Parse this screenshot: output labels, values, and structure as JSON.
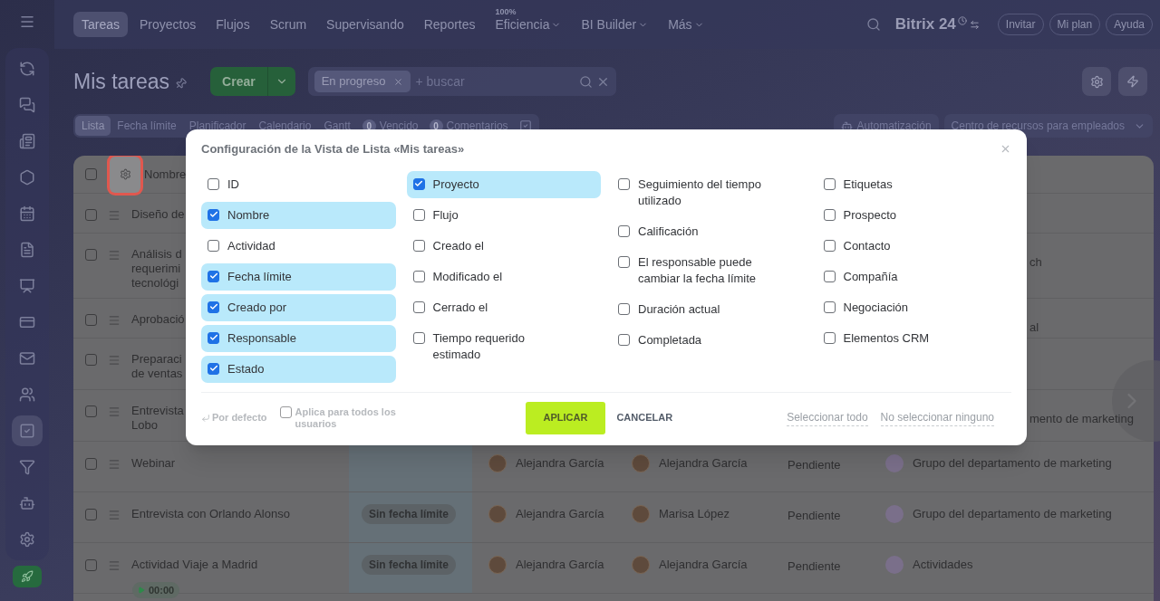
{
  "nav": {
    "items": [
      {
        "label": "Tareas",
        "selected": true
      },
      {
        "label": "Proyectos",
        "selected": false
      },
      {
        "label": "Flujos",
        "selected": false
      },
      {
        "label": "Scrum",
        "selected": false
      },
      {
        "label": "Supervisando",
        "selected": false
      },
      {
        "label": "Reportes",
        "selected": false
      },
      {
        "label": "Eficiencia",
        "selected": false,
        "badge": "100%",
        "dropdown": true
      },
      {
        "label": "BI Builder",
        "selected": false,
        "dropdown": true
      },
      {
        "label": "Más",
        "selected": false,
        "dropdown": true
      }
    ],
    "logo": "Bitrix 24",
    "buttons": [
      "Invitar",
      "Mi plan",
      "Ayuda"
    ]
  },
  "sidebar": {
    "items": [
      {
        "selected": false
      },
      {
        "selected": false
      },
      {
        "selected": false
      },
      {
        "selected": false
      },
      {
        "selected": false
      },
      {
        "selected": false
      },
      {
        "selected": false
      },
      {
        "selected": false
      },
      {
        "selected": false
      },
      {
        "selected": false
      },
      {
        "selected": true
      },
      {
        "selected": false
      },
      {
        "selected": false
      },
      {
        "selected": false
      }
    ]
  },
  "page": {
    "title": "Mis tareas",
    "create_button": "Crear",
    "search": {
      "chip": "En progreso",
      "placeholder": "+ buscar"
    }
  },
  "views": [
    {
      "label": "Lista",
      "selected": true
    },
    {
      "label": "Fecha límite",
      "selected": false
    },
    {
      "label": "Planificador",
      "selected": false
    },
    {
      "label": "Calendario",
      "selected": false
    },
    {
      "label": "Gantt",
      "selected": false
    }
  ],
  "counters": [
    {
      "count": "0",
      "label": "Vencido"
    },
    {
      "count": "0",
      "label": "Comentarios"
    }
  ],
  "automation": "Automatización",
  "resources": "Centro de recursos para empleados",
  "table": {
    "header": "Nombre",
    "header_checked": false,
    "rows": [
      {
        "kind": "partial",
        "checked": false,
        "name": "Diseño de"
      },
      {
        "kind": "partial",
        "checked": false,
        "name": "Análisis d\nrequerimi\ntecnológi",
        "end": "ch"
      },
      {
        "kind": "partial",
        "checked": false,
        "name": "Aprobació",
        "end": "al"
      },
      {
        "kind": "partial",
        "checked": false,
        "name": "Preparaci\nde ventas"
      },
      {
        "kind": "partial",
        "checked": false,
        "name": "Entrevista\nLobo",
        "end": "mento de marketing"
      },
      {
        "kind": "full",
        "checked": false,
        "name": "Webinar",
        "responsible": "Alejandra García",
        "creator": "Alejandra García",
        "status": "Pendiente",
        "project": "Grupo del departamento de marketing"
      },
      {
        "kind": "full",
        "checked": false,
        "name": "Entrevista con Orlando Alonso",
        "deadline": "Sin fecha límite",
        "responsible": "Alejandra García",
        "creator": "Marisa López",
        "status": "Pendiente",
        "project": "Grupo del departamento de marketing"
      },
      {
        "kind": "full",
        "checked": false,
        "name": "Actividad Viaje a Madrid",
        "deadline": "Sin fecha límite",
        "responsible": "Alejandra García",
        "creator": "Alejandra García",
        "status": "Pendiente",
        "project": "Actividades",
        "timer": "00:00"
      }
    ]
  },
  "dialog": {
    "title": "Configuración de la Vista de Lista «Mis tareas»",
    "columns": [
      [
        {
          "label": "ID",
          "checked": false
        },
        {
          "label": "Nombre",
          "checked": true
        },
        {
          "label": "Actividad",
          "checked": false
        },
        {
          "label": "Fecha límite",
          "checked": true
        },
        {
          "label": "Creado por",
          "checked": true
        },
        {
          "label": "Responsable",
          "checked": true
        },
        {
          "label": "Estado",
          "checked": true
        }
      ],
      [
        {
          "label": "Proyecto",
          "checked": true
        },
        {
          "label": "Flujo",
          "checked": false
        },
        {
          "label": "Creado el",
          "checked": false
        },
        {
          "label": "Modificado el",
          "checked": false
        },
        {
          "label": "Cerrado el",
          "checked": false
        },
        {
          "label": "Tiempo requerido estimado",
          "checked": false
        }
      ],
      [
        {
          "label": "Seguimiento del tiempo utilizado",
          "checked": false
        },
        {
          "label": "Calificación",
          "checked": false
        },
        {
          "label": "El responsable puede cambiar la fecha límite",
          "checked": false
        },
        {
          "label": "Duración actual",
          "checked": false
        },
        {
          "label": "Completada",
          "checked": false
        }
      ],
      [
        {
          "label": "Etiquetas",
          "checked": false
        },
        {
          "label": "Prospecto",
          "checked": false
        },
        {
          "label": "Contacto",
          "checked": false
        },
        {
          "label": "Compañía",
          "checked": false
        },
        {
          "label": "Negociación",
          "checked": false
        },
        {
          "label": "Elementos CRM",
          "checked": false
        }
      ]
    ],
    "reset": "Por defecto",
    "apply_all": {
      "label": "Aplica para todos los usuarios",
      "checked": false
    },
    "apply": "APLICAR",
    "cancel": "CANCELAR",
    "select_all": "Seleccionar todo",
    "select_none": "No seleccionar ninguno"
  }
}
